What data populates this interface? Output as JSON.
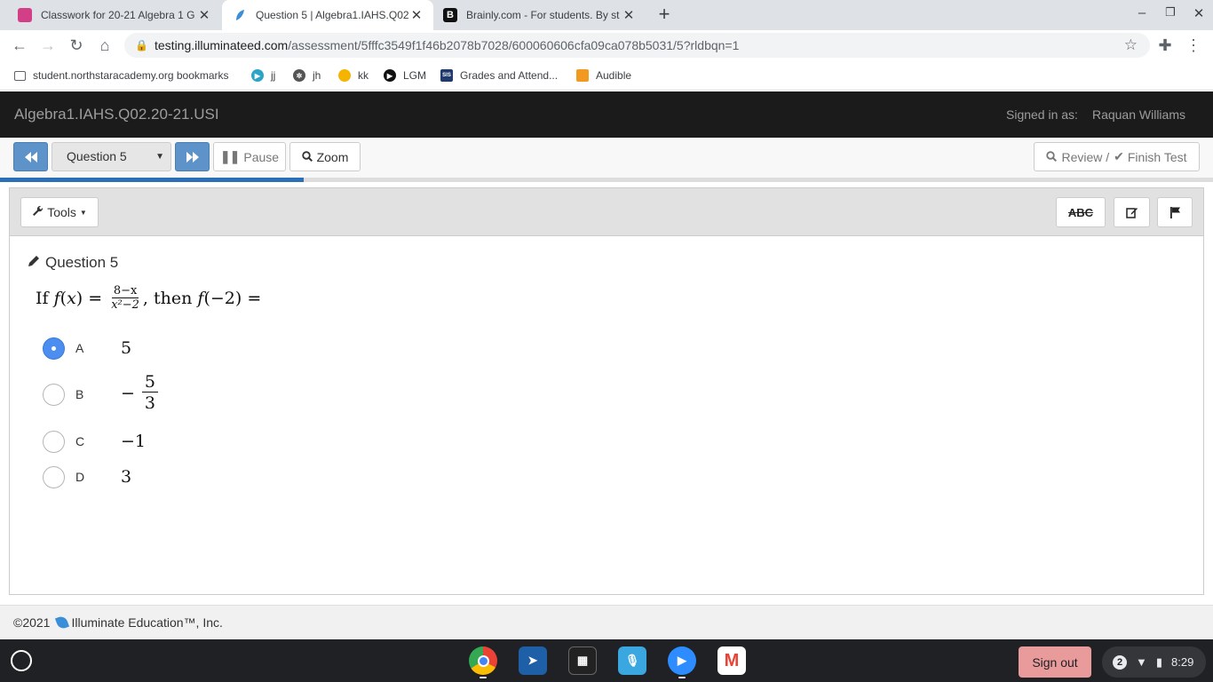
{
  "browser": {
    "tabs": [
      {
        "title": "Classwork for 20-21 Algebra 1 G",
        "favicon": "google-classroom-icon",
        "active": false
      },
      {
        "title": "Question 5 | Algebra1.IAHS.Q02",
        "favicon": "illuminate-leaf-icon",
        "active": true
      },
      {
        "title": "Brainly.com - For students. By st",
        "favicon": "brainly-icon",
        "active": false
      }
    ],
    "close_glyph": "✕",
    "new_tab_glyph": "+",
    "url_host": "testing.illuminateed.com",
    "url_path": "/assessment/5fffc3549f1f46b2078b7028/600060606cfa09ca078b5031/5?rldbqn=1",
    "bookmarks": [
      {
        "label": "student.northstaracademy.org bookmarks",
        "icon": "folder-icon"
      },
      {
        "label": "jj",
        "icon": "play-icon"
      },
      {
        "label": "jh",
        "icon": "film-reel-icon"
      },
      {
        "label": "kk",
        "icon": "hand-icon"
      },
      {
        "label": "LGM",
        "icon": "play-circle-icon"
      },
      {
        "label": "Grades and Attend...",
        "icon": "sis-icon",
        "icon_text": "SIS"
      },
      {
        "label": "Audible",
        "icon": "audible-icon"
      }
    ]
  },
  "app": {
    "title": "Algebra1.IAHS.Q02.20-21.USI",
    "signed_in_label": "Signed in as:",
    "user_name": "Raquan Williams"
  },
  "nav": {
    "question_select": "Question 5",
    "pause_label": "Pause",
    "zoom_label": "Zoom",
    "review_label": "Review /",
    "finish_label": "Finish Test",
    "progress_fraction": 0.25
  },
  "panel": {
    "tools_label": "Tools",
    "abc_label": "ABC",
    "question_title": "Question 5",
    "stem": {
      "prefix": "If",
      "fn": "f",
      "var": "x",
      "eq": "=",
      "num": "8−x",
      "den": "x²−2",
      "then": ", then",
      "arg": "(−2)",
      "eq2": "="
    },
    "choices": [
      {
        "letter": "A",
        "value": "5",
        "selected": true
      },
      {
        "letter": "B",
        "value_sign": "−",
        "value_num": "5",
        "value_den": "3",
        "selected": false
      },
      {
        "letter": "C",
        "value": "−1",
        "selected": false
      },
      {
        "letter": "D",
        "value": "3",
        "selected": false
      }
    ]
  },
  "footer": {
    "copyright": "©2021",
    "company": "Illuminate Education™, Inc."
  },
  "shelf": {
    "sign_out": "Sign out",
    "notif_count": "2",
    "time": "8:29"
  }
}
